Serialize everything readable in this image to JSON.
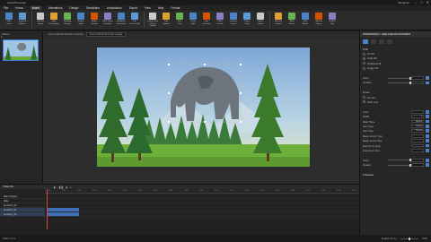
{
  "app": {
    "title": "ActivePresenter",
    "user": "Benjamin"
  },
  "menu": [
    "File",
    "Home",
    "Insert",
    "Animations",
    "Design",
    "Transitions",
    "Annotations",
    "Export",
    "View",
    "Help",
    "Format"
  ],
  "menu_active": 2,
  "ribbon": [
    [
      "New",
      "Insert"
    ],
    [
      "Duplicate",
      "Replace"
    ],
    [
      "Text Box",
      "Shape"
    ],
    [
      "Slide",
      "Text Caption"
    ],
    [
      "Spotlight",
      "Hotspot"
    ],
    [
      "Image",
      "Video"
    ],
    [
      "Audio",
      "Youtube"
    ],
    [
      "Web Object",
      "Equation"
    ],
    [
      "Feedback",
      "Interaction"
    ],
    [
      "Ink",
      "Cursor Path"
    ],
    [
      "Zoom-n-Pan",
      "Closed Caption"
    ],
    [
      "Icon",
      "Symbol"
    ],
    [
      "Date",
      "Time"
    ],
    [
      "Zoom",
      "Hide"
    ],
    [
      "Quiz",
      "Question"
    ],
    [
      "Field",
      "Custom"
    ],
    [
      "Dummy",
      "Cursor"
    ],
    [
      "Timer",
      "Chart"
    ],
    [
      "Layer",
      "Group"
    ],
    [
      "Record",
      "Screen"
    ],
    [
      "Slide",
      "Master"
    ],
    [
      "Quiz",
      "Report"
    ],
    [
      "Shared",
      "Objects"
    ],
    [
      "Guided",
      "Play"
    ]
  ],
  "left_panel": {
    "tools": "Slides",
    "slide_number": "1"
  },
  "stage": {
    "breadcrumb": "Scene with left first from a Zephyr",
    "pill": "Scene with left first from a page"
  },
  "properties": {
    "header": "PROPERTIES > SIZE AND ADJUSTMENT",
    "rows": [
      {
        "type": "section",
        "label": "Fill"
      },
      {
        "type": "check",
        "label": "No Fill",
        "on": false
      },
      {
        "type": "check",
        "label": "Solid Fill",
        "on": true
      },
      {
        "type": "check",
        "label": "Gradient Fill",
        "on": false
      },
      {
        "type": "check",
        "label": "Image Fill",
        "on": false
      },
      {
        "type": "blank"
      },
      {
        "type": "slider",
        "label": "Color"
      },
      {
        "type": "slider",
        "label": "Opacity"
      },
      {
        "type": "blank"
      },
      {
        "type": "section",
        "label": "Line"
      },
      {
        "type": "check",
        "label": "No Line",
        "on": false
      },
      {
        "type": "check",
        "label": "Solid Line",
        "on": true
      },
      {
        "type": "blank"
      },
      {
        "type": "value",
        "label": "Color",
        "value": ""
      },
      {
        "type": "value",
        "label": "Width",
        "value": "1"
      },
      {
        "type": "value",
        "label": "Dash Type",
        "value": "Round"
      },
      {
        "type": "value",
        "label": "Cap Type",
        "value": "Round"
      },
      {
        "type": "value",
        "label": "Join Type",
        "value": "Round"
      },
      {
        "type": "value",
        "label": "Begin Arrow Type",
        "value": ""
      },
      {
        "type": "value",
        "label": "Begin Arrow Size",
        "value": ""
      },
      {
        "type": "value",
        "label": "End Arrow Type",
        "value": ""
      },
      {
        "type": "value",
        "label": "End Arrow Size",
        "value": ""
      },
      {
        "type": "blank"
      },
      {
        "type": "slider",
        "label": "Color"
      },
      {
        "type": "slider",
        "label": "Opacity"
      },
      {
        "type": "blank"
      },
      {
        "type": "section",
        "label": "Shadow"
      }
    ]
  },
  "timeline": {
    "title": "TIMELINE",
    "ruler": [
      "0:00",
      "0:01",
      "0:02",
      "0:03",
      "0:04",
      "0:05",
      "0:06",
      "0:07",
      "0:08",
      "0:09",
      "0:10",
      "0:11",
      "0:12",
      "0:13",
      "0:14",
      "0:15",
      "0:16",
      "0:17",
      "0:18",
      "0:19",
      "0:20"
    ],
    "tracks": [
      {
        "label": "Main Timeline",
        "selected": false
      },
      {
        "label": "Slide",
        "selected": false
      },
      {
        "label": "Freeform_93",
        "selected": false
      },
      {
        "label": "Freeform_94",
        "selected": true
      },
      {
        "label": "Freeform_95",
        "selected": true
      }
    ]
  },
  "status": {
    "left": "Slide 1 of 1",
    "lang": "English (U.S.)",
    "zoom": "63%"
  }
}
